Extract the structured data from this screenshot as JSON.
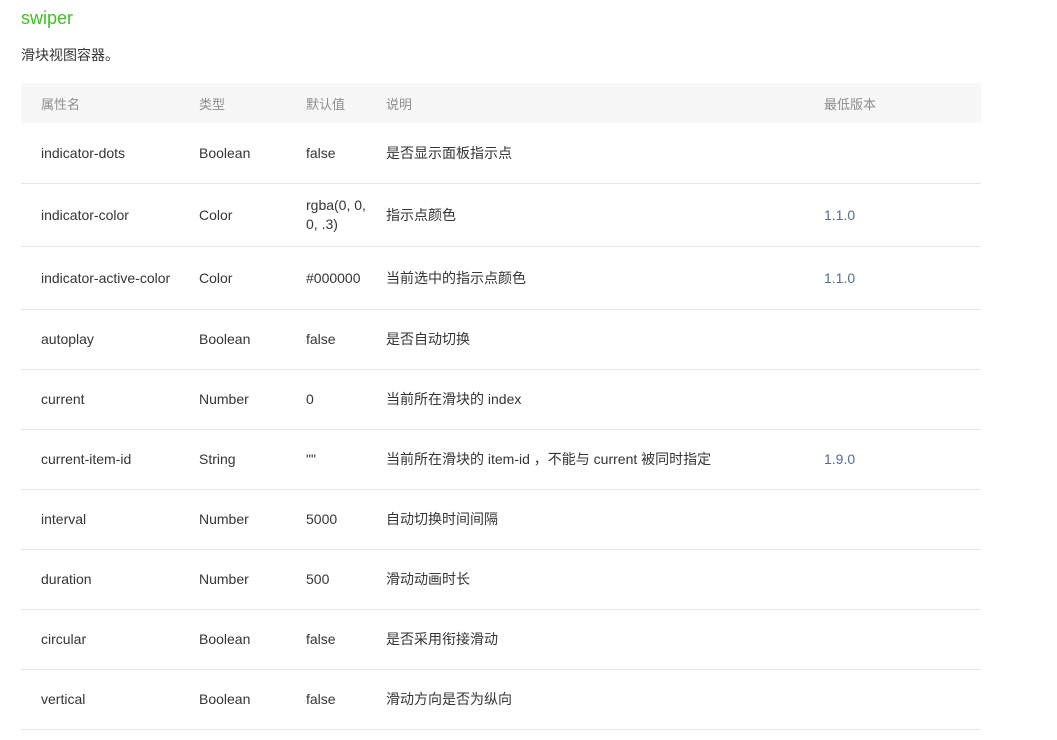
{
  "heading": "swiper",
  "description": "滑块视图容器。",
  "table": {
    "headers": [
      "属性名",
      "类型",
      "默认值",
      "说明",
      "最低版本"
    ],
    "rows": [
      {
        "name": "indicator-dots",
        "type": "Boolean",
        "default": "false",
        "desc": "是否显示面板指示点",
        "version": ""
      },
      {
        "name": "indicator-color",
        "type": "Color",
        "default": "rgba(0, 0, 0, .3)",
        "desc": "指示点颜色",
        "version": "1.1.0"
      },
      {
        "name": "indicator-active-color",
        "type": "Color",
        "default": "#000000",
        "desc": "当前选中的指示点颜色",
        "version": "1.1.0"
      },
      {
        "name": "autoplay",
        "type": "Boolean",
        "default": "false",
        "desc": "是否自动切换",
        "version": ""
      },
      {
        "name": "current",
        "type": "Number",
        "default": "0",
        "desc": "当前所在滑块的 index",
        "version": ""
      },
      {
        "name": "current-item-id",
        "type": "String",
        "default": "\"\"",
        "desc": "当前所在滑块的 item-id ，不能与 current 被同时指定",
        "version": "1.9.0"
      },
      {
        "name": "interval",
        "type": "Number",
        "default": "5000",
        "desc": "自动切换时间间隔",
        "version": ""
      },
      {
        "name": "duration",
        "type": "Number",
        "default": "500",
        "desc": "滑动动画时长",
        "version": ""
      },
      {
        "name": "circular",
        "type": "Boolean",
        "default": "false",
        "desc": "是否采用衔接滑动",
        "version": ""
      },
      {
        "name": "vertical",
        "type": "Boolean",
        "default": "false",
        "desc": "滑动方向是否为纵向",
        "version": ""
      }
    ]
  },
  "colors": {
    "heading": "#3cc51f",
    "version_link": "#576b95",
    "header_bg": "#f7f7f7"
  }
}
